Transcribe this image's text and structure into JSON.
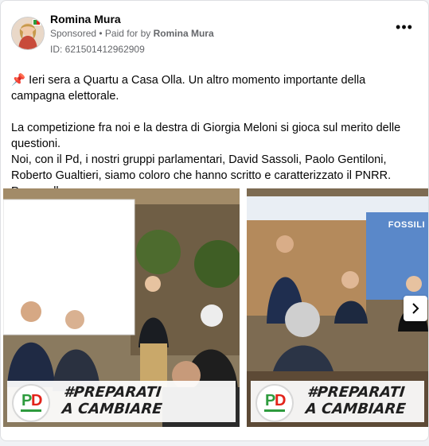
{
  "post": {
    "author": "Romina Mura",
    "sponsored": "Sponsored",
    "paid_prefix": " • Paid for by ",
    "paid_by": "Romina Mura",
    "ad_id": "ID: 621501412962909",
    "more_icon": "more-horizontal-icon"
  },
  "body": {
    "line1": "Ieri sera a Quartu a Casa Olla. Un altro momento importante della campagna elettorale.",
    "line2": "La competizione fra noi e la destra di Giorgia Meloni si gioca sul merito delle questioni.",
    "line3": "Noi, con il Pd, i nostri gruppi parlamentari, David Sassoli, Paolo Gentiloni, Roberto Gualtieri, siamo coloro che hanno scritto e caratterizzato il PNRR. Penso alle…"
  },
  "carousel": {
    "slides": [
      {
        "slogan_line1": "#PREPARATI",
        "slogan_line2": "A CAMBIARE"
      },
      {
        "slogan_line1": "#PREPARATI",
        "slogan_line2": "A CAMBIARE",
        "screen_text": "FOSSILI"
      }
    ],
    "next_icon": "chevron-right-icon"
  },
  "colors": {
    "pd_green": "#2e9b3e",
    "pd_red": "#e2231a",
    "text": "#050505",
    "muted": "#65676b"
  }
}
